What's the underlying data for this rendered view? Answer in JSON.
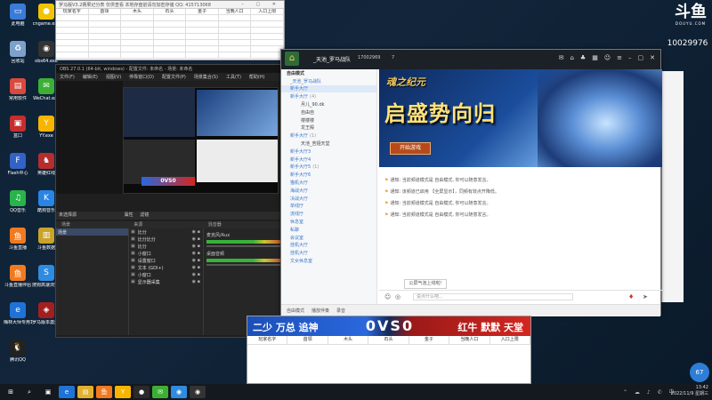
{
  "desktop_icons": [
    {
      "label": "此电脑",
      "icon": "computer-icon",
      "color": "#3b7bd8",
      "glyph": "▭"
    },
    {
      "label": "cngame.exe",
      "icon": "pacman-icon",
      "color": "#f2c400",
      "glyph": "●"
    },
    {
      "label": "回收站",
      "icon": "recycle-bin-icon",
      "color": "#7da1c9",
      "glyph": "♻"
    },
    {
      "label": "obs64.exe",
      "icon": "obs-icon",
      "color": "#333333",
      "glyph": "◉"
    },
    {
      "label": "常用软件",
      "icon": "folder-icon",
      "color": "#d94a3d",
      "glyph": "▤"
    },
    {
      "label": "WeChat.exe",
      "icon": "wechat-icon",
      "color": "#3cb034",
      "glyph": "✉"
    },
    {
      "label": "盒口",
      "icon": "app-icon",
      "color": "#c62d2d",
      "glyph": "▣"
    },
    {
      "label": "YY.exe",
      "icon": "yy-icon",
      "color": "#f7b500",
      "glyph": "Y"
    },
    {
      "label": "Flash中心",
      "icon": "flash-icon",
      "color": "#3262c4",
      "glyph": "F"
    },
    {
      "label": "英雄红线",
      "icon": "hero-icon",
      "color": "#b52d2d",
      "glyph": "♞"
    },
    {
      "label": "QQ音乐",
      "icon": "qqmusic-icon",
      "color": "#29b34b",
      "glyph": "♫"
    },
    {
      "label": "酷狗音乐",
      "icon": "kugou-icon",
      "color": "#2a84e5",
      "glyph": "K"
    },
    {
      "label": "斗鱼直播",
      "icon": "douyu-icon",
      "color": "#f07a20",
      "glyph": "鱼"
    },
    {
      "label": "斗鱼数据",
      "icon": "chart-app-icon",
      "color": "#c9a32a",
      "glyph": "▥"
    },
    {
      "label": "斗鱼直播伴侣",
      "icon": "douyu-companion-icon",
      "color": "#f07a20",
      "glyph": "鱼"
    },
    {
      "label": "搜狗高速浏览器",
      "icon": "sogou-icon",
      "color": "#2f8be0",
      "glyph": "S"
    },
    {
      "label": "梅林大师专用1.0",
      "icon": "edge-icon",
      "color": "#1f73d6",
      "glyph": "e"
    },
    {
      "label": "罗马版本激活版",
      "icon": "game-icon",
      "color": "#a31f1f",
      "glyph": "◈"
    },
    {
      "label": "腾讯QQ",
      "icon": "qq-icon",
      "color": "#222222",
      "glyph": "🐧"
    }
  ],
  "sheet_top": {
    "title": "罗马版V3.2赛果记分表 仅供查看 本地存盘前请勿加密存储  QQ: 415713068",
    "headers": [
      "玩家名字",
      "首领",
      "木头",
      "石头",
      "金子",
      "当晚人口",
      "入口上限"
    ]
  },
  "obs": {
    "title": "OBS 27.0.1 (64-bit, windows) - 配置文件: 未命名 - 场景: 未命名",
    "menu": [
      "文件(F)",
      "编辑(E)",
      "视图(V)",
      "停靠窗口(D)",
      "配置文件(P)",
      "场景集合(S)",
      "工具(T)",
      "帮助(H)"
    ],
    "left_label": "未选择源",
    "props_btn": "属性",
    "filter_btn": "滤镜",
    "dock_titles": [
      "场景",
      "来源",
      "混音器"
    ],
    "scene_items": [
      "场景"
    ],
    "sources": [
      "比分",
      "比分比分",
      "比分",
      "小窗口",
      "设置窗口",
      "文本 (GDI+)",
      "小窗口",
      "显示器采集"
    ],
    "mixer": [
      {
        "label": "麦克风/Aux"
      },
      {
        "label": "桌面音频"
      }
    ],
    "preview_label": "0VS0"
  },
  "brand": {
    "logo": "斗鱼",
    "logo_sub": "DOUYU.COM",
    "room_id": "10029976"
  },
  "yy": {
    "channel_name": "_天池_罗马战队",
    "channel_id": "17002969",
    "channel_count": "7",
    "sidebar": [
      {
        "label": "自由模式",
        "kind": "header",
        "cnt": ""
      },
      {
        "label": "_天池_罗马战队",
        "kind": "sub",
        "cnt": ""
      },
      {
        "label": "新手大厅",
        "kind": "sub",
        "cnt": ""
      },
      {
        "label": "新手大厅",
        "kind": "sub",
        "cnt": "(4)"
      },
      {
        "label": "月儿_90.dk",
        "kind": "user",
        "cnt": ""
      },
      {
        "label": "自由自",
        "kind": "user",
        "cnt": ""
      },
      {
        "label": "楼楼楼",
        "kind": "user",
        "cnt": ""
      },
      {
        "label": "龙王殿",
        "kind": "user",
        "cnt": ""
      },
      {
        "label": "新手大厅",
        "kind": "sub",
        "cnt": "(1)"
      },
      {
        "label": "天池_苦娅天堂",
        "kind": "user",
        "cnt": ""
      },
      {
        "label": "新手大厅3",
        "kind": "sub",
        "cnt": ""
      },
      {
        "label": "新手大厅4",
        "kind": "sub",
        "cnt": ""
      },
      {
        "label": "新手大厅5",
        "kind": "sub",
        "cnt": "(1)"
      },
      {
        "label": "新手大厅6",
        "kind": "sub",
        "cnt": ""
      },
      {
        "label": "猫机大厅",
        "kind": "sub",
        "cnt": ""
      },
      {
        "label": "海战大厅",
        "kind": "sub",
        "cnt": ""
      },
      {
        "label": "决战大厅",
        "kind": "sub",
        "cnt": ""
      },
      {
        "label": "单线厅",
        "kind": "sub",
        "cnt": ""
      },
      {
        "label": "流线厅",
        "kind": "sub",
        "cnt": ""
      },
      {
        "label": "休息室",
        "kind": "sub",
        "cnt": ""
      },
      {
        "label": "私聊",
        "kind": "sub",
        "cnt": ""
      },
      {
        "label": "会议室",
        "kind": "sub",
        "cnt": ""
      },
      {
        "label": "挂机大厅",
        "kind": "sub",
        "cnt": ""
      },
      {
        "label": "挂机大厅",
        "kind": "sub",
        "cnt": ""
      },
      {
        "label": "文女休息室",
        "kind": "sub",
        "cnt": ""
      }
    ],
    "banner_logo": "魂之纪元",
    "banner_text": "启盛势向归",
    "banner_button": "开始游戏",
    "messages": [
      "通知: 当前频道模式是 自由模式, 你可以随意发言。",
      "通知: 该频道已启用 【全屏显示】，同频有效点开降低。",
      "通知: 当前频道模式是 自由模式, 你可以随意发言。",
      "通知: 当前频道模式是 自由模式, 你可以随意发言。"
    ],
    "tooltip": "公屏气泡上线啦!",
    "input_placeholder": "说点什么吧...",
    "bottom_items": [
      "自由模式",
      "播放伴奏",
      "录音"
    ]
  },
  "score": {
    "team_left": "二少 万总 追神",
    "vs": "0VS0",
    "team_right": "红牛 默默 天堂",
    "headers": [
      "玩家名字",
      "首领",
      "木头",
      "石头",
      "金子",
      "当晚人口",
      "入口上限"
    ]
  },
  "speed_badge": "67",
  "taskbar": {
    "time": "13:42",
    "date": "2022/11/9 星期三",
    "apps": [
      {
        "icon": "windows-start-icon",
        "glyph": "⊞",
        "color": "#14181f"
      },
      {
        "icon": "search-icon",
        "glyph": "⌕",
        "color": "#14181f"
      },
      {
        "icon": "task-view-icon",
        "glyph": "▣",
        "color": "#14181f"
      },
      {
        "icon": "edge-icon",
        "glyph": "e",
        "color": "#1f73d6"
      },
      {
        "icon": "file-explorer-icon",
        "glyph": "▤",
        "color": "#e0b030"
      },
      {
        "icon": "douyu-icon",
        "glyph": "鱼",
        "color": "#f07a20"
      },
      {
        "icon": "yy-icon",
        "glyph": "Y",
        "color": "#f7b500"
      },
      {
        "icon": "qq-icon",
        "glyph": "●",
        "color": "#2a2a2a"
      },
      {
        "icon": "wechat-icon",
        "glyph": "✉",
        "color": "#3cb034"
      },
      {
        "icon": "chrome-icon",
        "glyph": "◉",
        "color": "#2f8be0"
      },
      {
        "icon": "obs-icon",
        "glyph": "◉",
        "color": "#333333"
      }
    ]
  },
  "colors": {
    "yy_topbar": "#1b2127",
    "score_blue": "#1b4fb8",
    "score_red": "#d42621"
  }
}
